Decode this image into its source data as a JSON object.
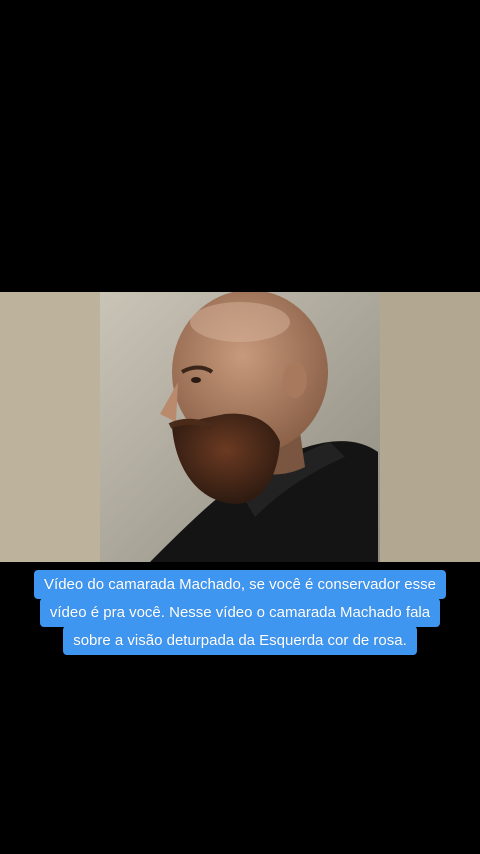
{
  "caption": {
    "lines": [
      "Vídeo do camarada Machado, se você é conservador esse",
      "vídeo é pra você. Nesse vídeo o camarada Machado fala",
      "sobre a visão deturpada da Esquerda cor de rosa."
    ],
    "background_color": "#3f96f0",
    "text_color": "#ffffff"
  },
  "video": {
    "subject": "bald bearded man in profile wearing dark jacket"
  }
}
